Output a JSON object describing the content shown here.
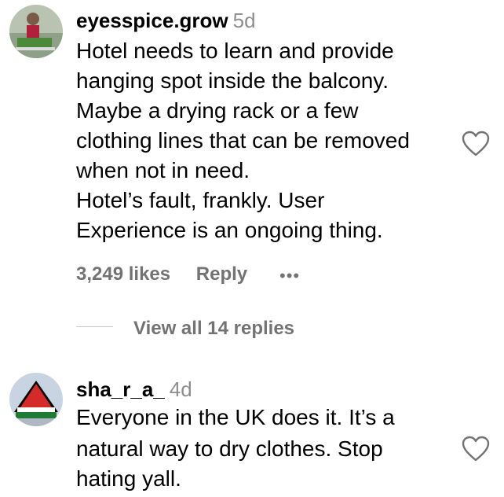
{
  "comments": [
    {
      "username": "eyesspice.grow",
      "age": "5d",
      "lines": [
        "Hotel needs to learn and provide",
        "hanging spot inside the balcony.",
        "Maybe a drying rack or a few",
        "clothing lines that can be removed",
        "when not in need.",
        "Hotel’s fault, frankly. User",
        "Experience is an ongoing thing."
      ],
      "likes": "3,249 likes",
      "reply": "Reply",
      "more": "•••",
      "view_replies": "View all 14 replies"
    },
    {
      "username": "sha_r_a_",
      "age": "4d",
      "lines": [
        "Everyone in the UK does it. It’s a",
        "natural way to dry clothes. Stop",
        "hating yall."
      ]
    }
  ],
  "icons": {
    "like": "heart-outline-icon",
    "more": "more-options-icon"
  },
  "colors": {
    "text": "#000000",
    "muted": "#737373",
    "age": "#8e8e8e",
    "divider": "#c7c7c7"
  }
}
